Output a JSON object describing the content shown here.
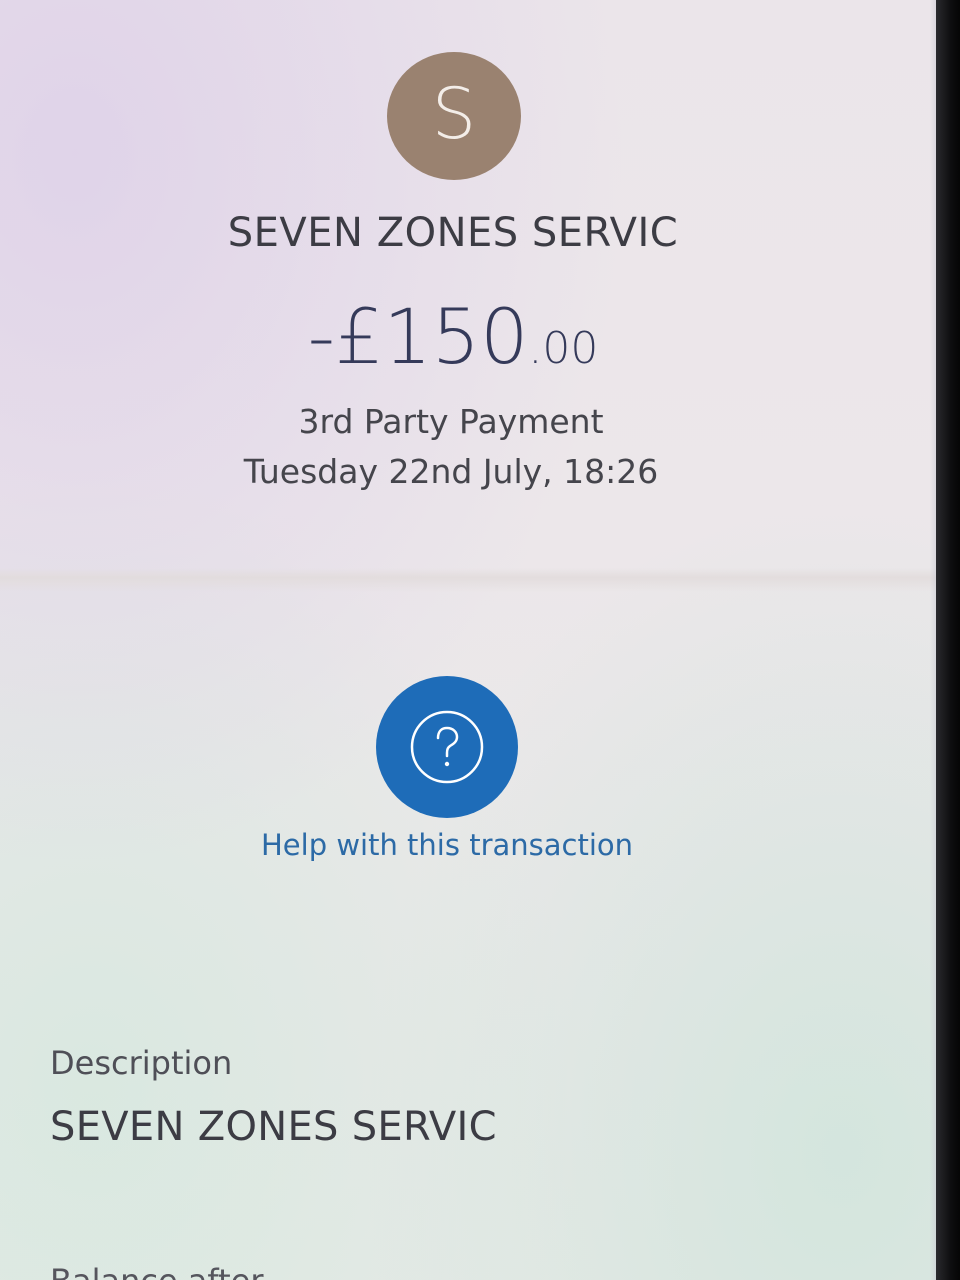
{
  "transaction": {
    "avatar_letter": "S",
    "merchant_name": "SEVEN ZONES SERVIC",
    "amount_main": "-£150",
    "amount_pence": ".00",
    "type": "3rd Party Payment",
    "datetime": "Tuesday 22nd July, 18:26"
  },
  "help": {
    "icon": "question-circle-icon",
    "label": "Help with this transaction"
  },
  "details": {
    "description_label": "Description",
    "description_value": "SEVEN ZONES SERVIC",
    "next_label_partial": "Balance after"
  },
  "colors": {
    "avatar_bg": "#9a8270",
    "help_button_bg": "#1e6cb8",
    "help_label": "#2c6aa6",
    "amount_text": "#353a5a"
  }
}
